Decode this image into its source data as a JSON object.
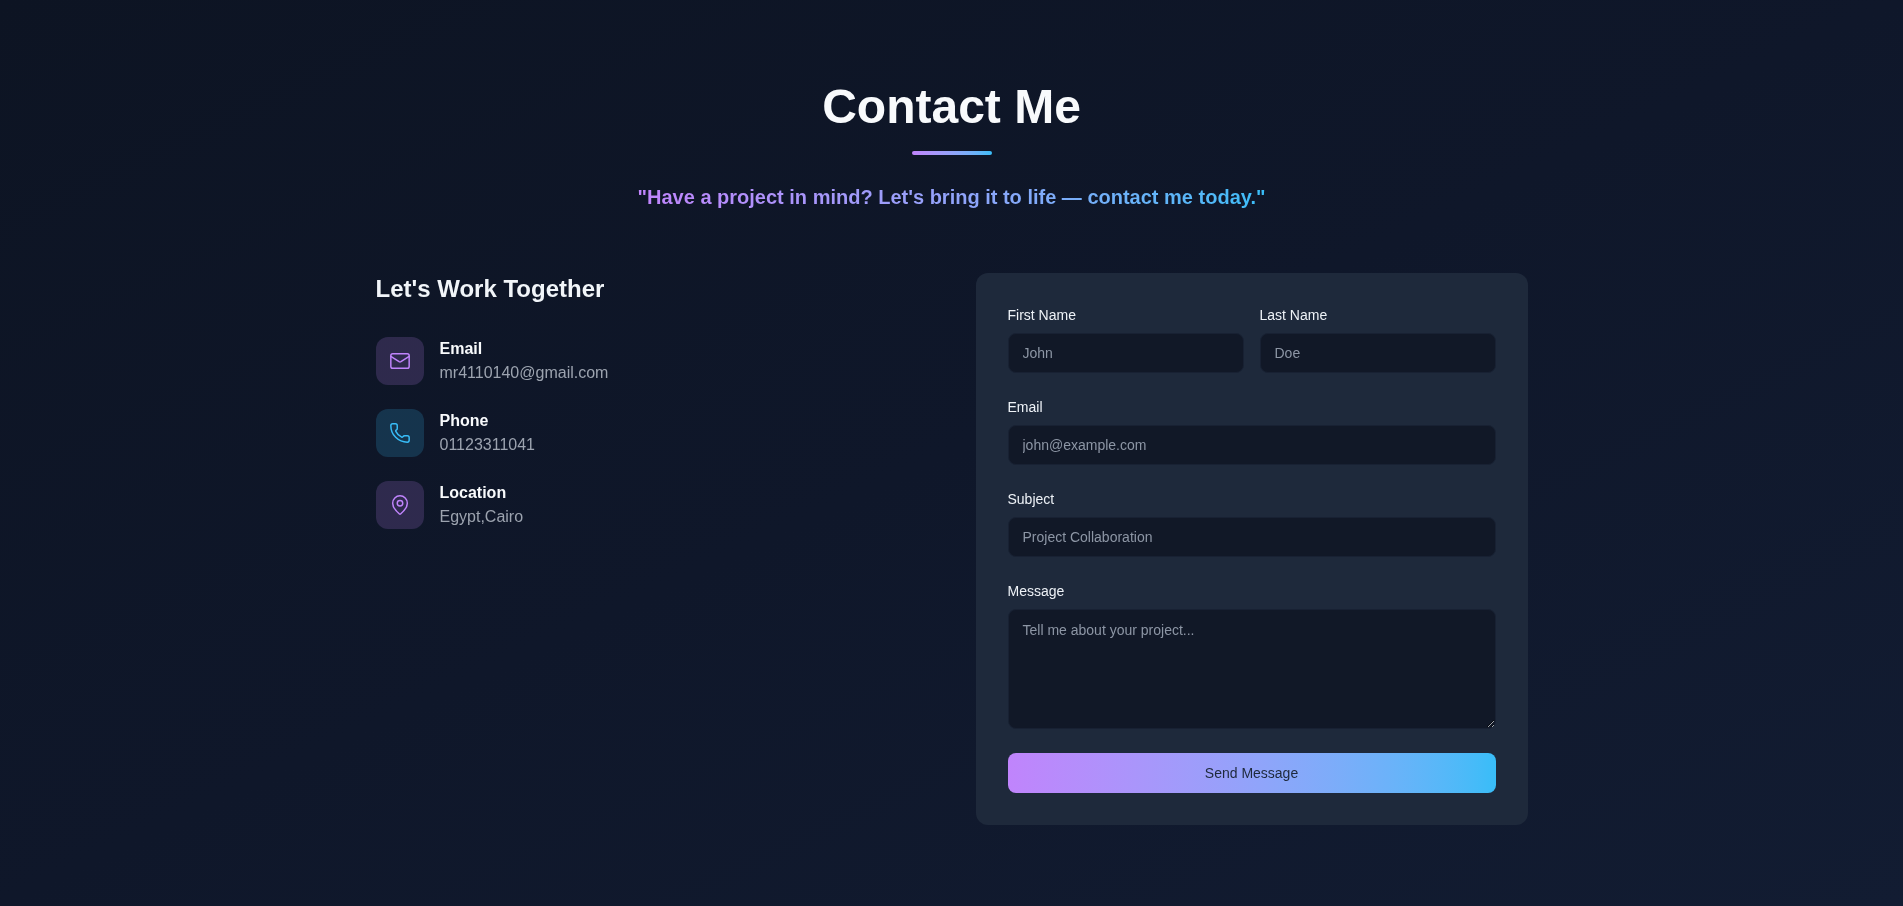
{
  "header": {
    "title": "Contact Me",
    "subtitle": "\"Have a project in mind? Let's bring it to life — contact me today.\""
  },
  "info": {
    "heading": "Let's Work Together",
    "items": [
      {
        "kind": "email",
        "label": "Email",
        "value": "mr4110140@gmail.com",
        "color": "#c084fc"
      },
      {
        "kind": "phone",
        "label": "Phone",
        "value": "01123311041",
        "color": "#38bdf8"
      },
      {
        "kind": "location",
        "label": "Location",
        "value": "Egypt,Cairo",
        "color": "#c084fc"
      }
    ]
  },
  "form": {
    "rows": [
      [
        {
          "kind": "input",
          "label": "First Name",
          "placeholder": "John"
        },
        {
          "kind": "input",
          "label": "Last Name",
          "placeholder": "Doe"
        }
      ],
      [
        {
          "kind": "input",
          "label": "Email",
          "placeholder": "john@example.com"
        }
      ],
      [
        {
          "kind": "input",
          "label": "Subject",
          "placeholder": "Project Collaboration"
        }
      ],
      [
        {
          "kind": "textarea",
          "label": "Message",
          "placeholder": "Tell me about your project..."
        }
      ]
    ],
    "submit": "Send Message"
  }
}
